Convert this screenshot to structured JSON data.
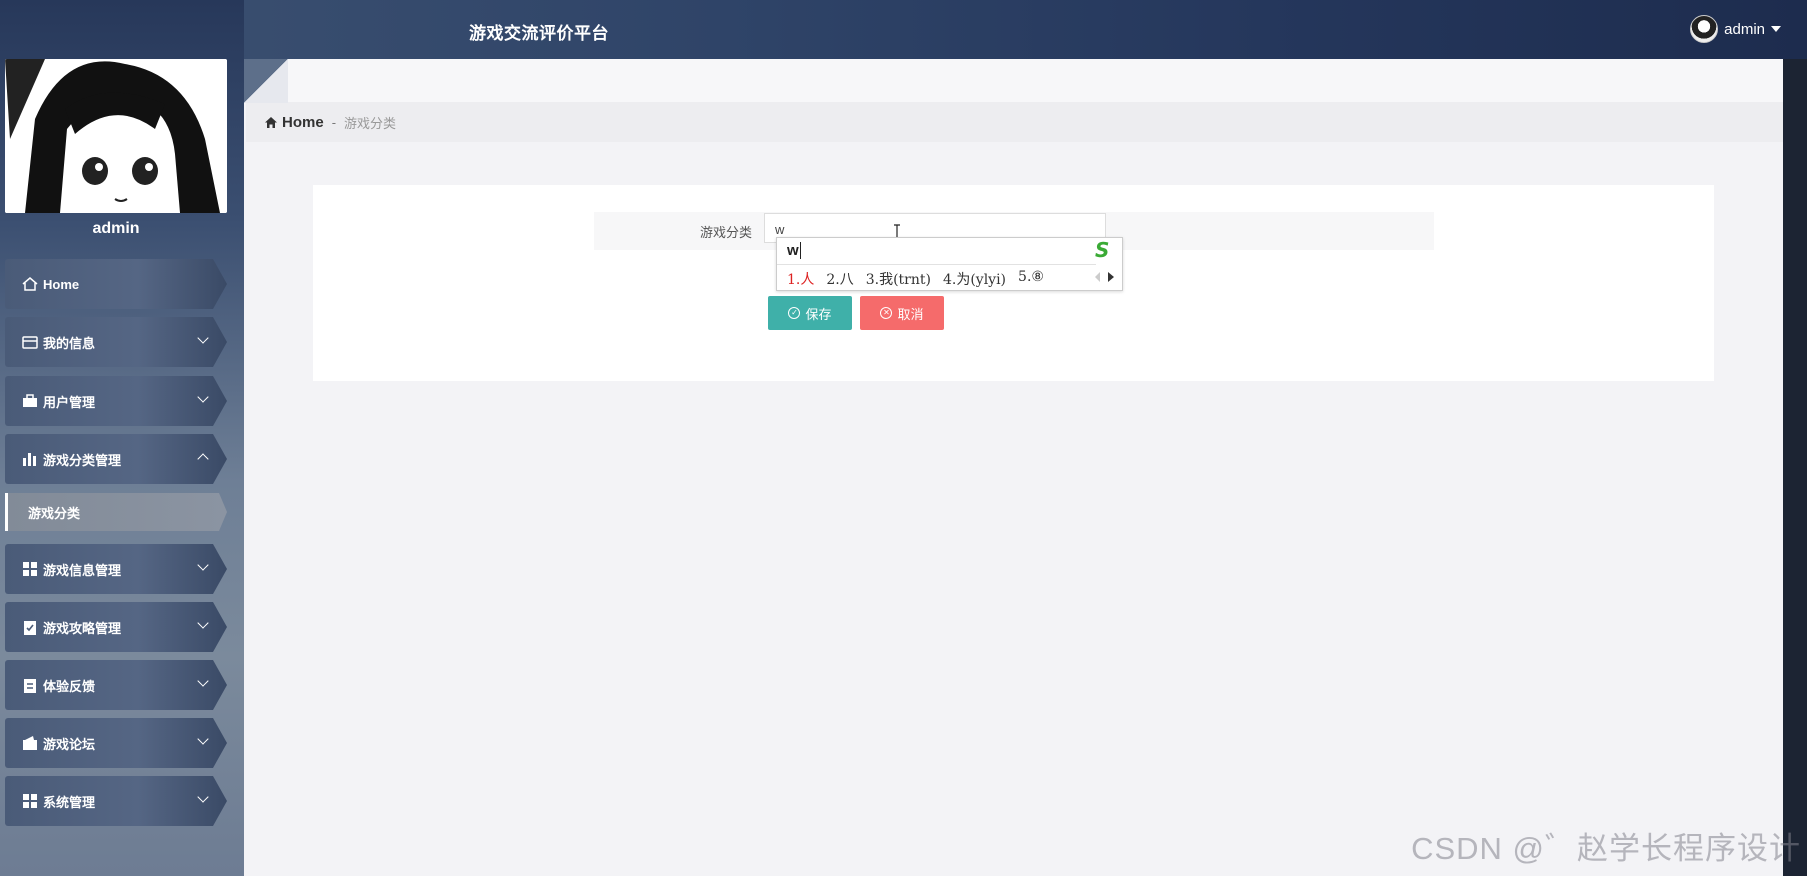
{
  "header": {
    "site_title": "游戏交流评价平台",
    "user_name": "admin"
  },
  "sidebar": {
    "profile_name": "admin",
    "items": [
      {
        "label": "Home",
        "icon": "home-icon"
      },
      {
        "label": "我的信息",
        "icon": "wallet-icon"
      },
      {
        "label": "用户管理",
        "icon": "briefcase-icon"
      },
      {
        "label": "游戏分类管理",
        "icon": "bar-chart-icon",
        "expanded": true
      },
      {
        "label": "游戏信息管理",
        "icon": "grid-icon"
      },
      {
        "label": "游戏攻略管理",
        "icon": "clipboard-check-icon"
      },
      {
        "label": "体验反馈",
        "icon": "clipboard-icon"
      },
      {
        "label": "游戏论坛",
        "icon": "wallet-icon"
      },
      {
        "label": "系统管理",
        "icon": "grid-icon"
      }
    ],
    "sub_items": [
      {
        "label": "游戏分类",
        "active": true
      }
    ]
  },
  "breadcrumb": {
    "home": "Home",
    "separator": "-",
    "current": "游戏分类"
  },
  "form": {
    "label": "游戏分类",
    "input_value": "w",
    "save_label": "保存",
    "cancel_label": "取消"
  },
  "ime": {
    "composition": "w",
    "candidates": [
      "1.人",
      "2.八",
      "3.我(trnt)",
      "4.为(ylyi)",
      "5.⑧"
    ],
    "logo": "S"
  },
  "watermark": "CSDN @゛赵学长程序设计",
  "colors": {
    "save": "#3fb0a9",
    "cancel": "#f56b6b",
    "topbar": "#2f4468"
  }
}
